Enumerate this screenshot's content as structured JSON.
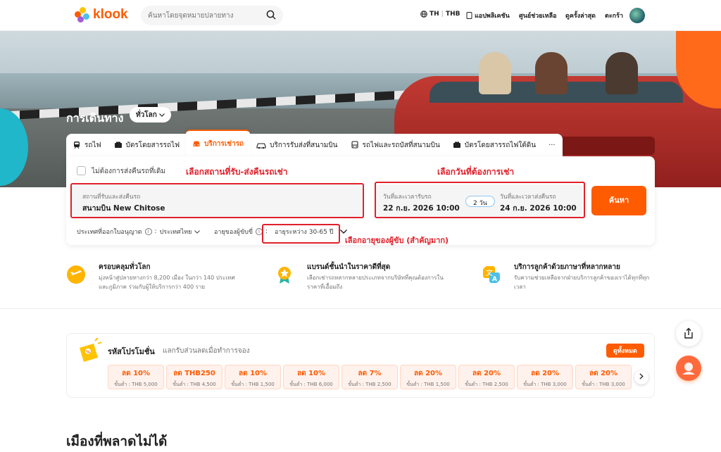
{
  "topbar": {
    "logo_text": "klook",
    "search_placeholder": "ค้นหาโดยจุดหมายปลายทาง",
    "lang": "TH",
    "currency": "THB",
    "app_label": "แอปพลิเคชัน",
    "help_label": "ศูนย์ช่วยเหลือ",
    "recent_label": "ดูครั้งล่าสุด",
    "cart_label": "ตะกร้า"
  },
  "hero": {
    "title": "การเดินทาง",
    "scope": "ทั่วโลก"
  },
  "tabs": [
    {
      "label": "รถไฟ",
      "icon": "train-icon"
    },
    {
      "label": "บัตรโดยสารรถไฟ",
      "icon": "rail-pass-icon"
    },
    {
      "label": "บริการเช่ารถ",
      "icon": "car-icon",
      "active": true
    },
    {
      "label": "บริการรับส่งที่สนามบิน",
      "icon": "airport-transfer-icon"
    },
    {
      "label": "รถไฟและรถบัสที่สนามบิน",
      "icon": "bus-icon"
    },
    {
      "label": "บัตรโดยสารรถไฟใต้ดิน",
      "icon": "metro-icon"
    }
  ],
  "tabs_more": "···",
  "form": {
    "return_checkbox_label": "ไม่ต้องการส่งคืนรถที่เดิม",
    "note_location": "เลือกสถานที่รับ-ส่งคืนรถเช่า",
    "note_date": "เลือกวันที่ต้องการเช่า",
    "note_age": "เลือกอายุของผู้ขับ (สำคัญมาก)",
    "location_label": "สถานที่รับและส่งคืนรถ",
    "location_value": "สนามบิน New Chitose",
    "pickup_label": "วันที่และเวลารับรถ",
    "pickup_value": "22 ก.ย. 2026 10:00",
    "days": "2 วัน",
    "dropoff_label": "วันที่และเวลาส่งคืนรถ",
    "dropoff_value": "24 ก.ย. 2026 10:00",
    "search_button": "ค้นหา",
    "license_label": "ประเทศที่ออกใบอนุญาต",
    "license_value": "ประเทศไทย",
    "age_label": "อายุของผู้ขับขี่",
    "age_value": "อายุระหว่าง 30-65 ปี"
  },
  "features": [
    {
      "title": "ครอบคลุมทั่วโลก",
      "desc": "มุ่งหน้าสู่ปลายทางกว่า 8,200 เมือง ในกว่า 140 ประเทศและภูมิภาค ร่วมกับผู้ให้บริการกว่า 400 ราย"
    },
    {
      "title": "แบรนด์ชั้นนำในราคาดีที่สุด",
      "desc": "เลือกเช่ารถหลากหลายประเภทจากบริษัทที่คุณต้องการในราคาที่เอื้อมถึง"
    },
    {
      "title": "บริการลูกค้าด้วยภาษาที่หลากหลาย",
      "desc": "รับความช่วยเหลือจากฝ่ายบริการลูกค้าของเราได้ทุกที่ทุกเวลา"
    }
  ],
  "promo": {
    "title": "รหัสโปรโมชั่น",
    "subtitle": "แลกรับส่วนลดเมื่อทำการจอง",
    "see_all": "ดูทั้งหมด",
    "coupons": [
      {
        "main": "ลด 10%",
        "sub": "ขั้นต่ำ : THB 5,000"
      },
      {
        "main": "ลด THB250",
        "sub": "ขั้นต่ำ : THB 4,500"
      },
      {
        "main": "ลด 10%",
        "sub": "ขั้นต่ำ : THB 1,500"
      },
      {
        "main": "ลด 10%",
        "sub": "ขั้นต่ำ : THB 6,000"
      },
      {
        "main": "ลด 7%",
        "sub": "ขั้นต่ำ : THB 2,500"
      },
      {
        "main": "ลด 20%",
        "sub": "ขั้นต่ำ : THB 1,500"
      },
      {
        "main": "ลด 20%",
        "sub": "ขั้นต่ำ : THB 2,500"
      },
      {
        "main": "ลด 20%",
        "sub": "ขั้นต่ำ : THB 3,000"
      },
      {
        "main": "ลด 20%",
        "sub": "ขั้นต่ำ : THB 3,000"
      }
    ]
  },
  "section_title": "เมืองที่พลาดไม่ได้",
  "colors": {
    "accent": "#ff5b00",
    "annotation": "#e0202a"
  }
}
